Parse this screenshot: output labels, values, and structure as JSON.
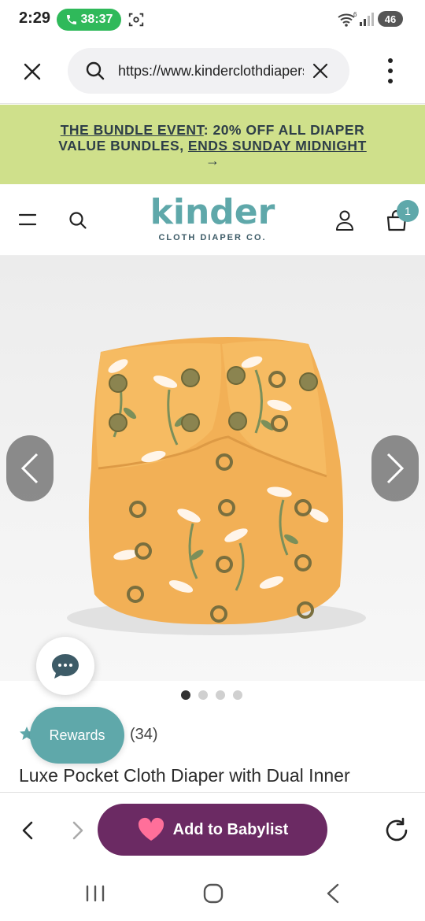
{
  "status_bar": {
    "time": "2:29",
    "call_duration": "38:37",
    "battery": "46",
    "wifi_label": "6"
  },
  "browser": {
    "url": "https://www.kinderclothdiapers.com",
    "icons": [
      "close-icon",
      "search-icon",
      "clear-icon",
      "more-vert-icon"
    ]
  },
  "promo": {
    "line1_prefix": "THE BUNDLE EVENT",
    "line1_suffix": ": 20% OFF ALL DIAPER",
    "line2_prefix": "VALUE BUNDLES, ",
    "line2_link": "ENDS SUNDAY MIDNIGHT",
    "arrow": "→"
  },
  "site_header": {
    "logo_main": "kinder",
    "logo_sub": "CLOTH DIAPER CO.",
    "cart_count": "1"
  },
  "product": {
    "image_alt": "Orange floral pocket cloth diaper with snaps",
    "carousel_total": 4,
    "carousel_active": 1,
    "review_count": "(34)",
    "title": "Luxe Pocket Cloth Diaper with Dual Inner"
  },
  "widgets": {
    "rewards_label": "Rewards"
  },
  "bottom_toolbar": {
    "babylist_label": "Add to Babylist"
  },
  "colors": {
    "promo_bg": "#cfe08b",
    "brand_teal": "#5fa8aa",
    "babylist_purple": "#6b2a63",
    "call_green": "#2fb95a",
    "diaper_orange": "#f2b056"
  }
}
